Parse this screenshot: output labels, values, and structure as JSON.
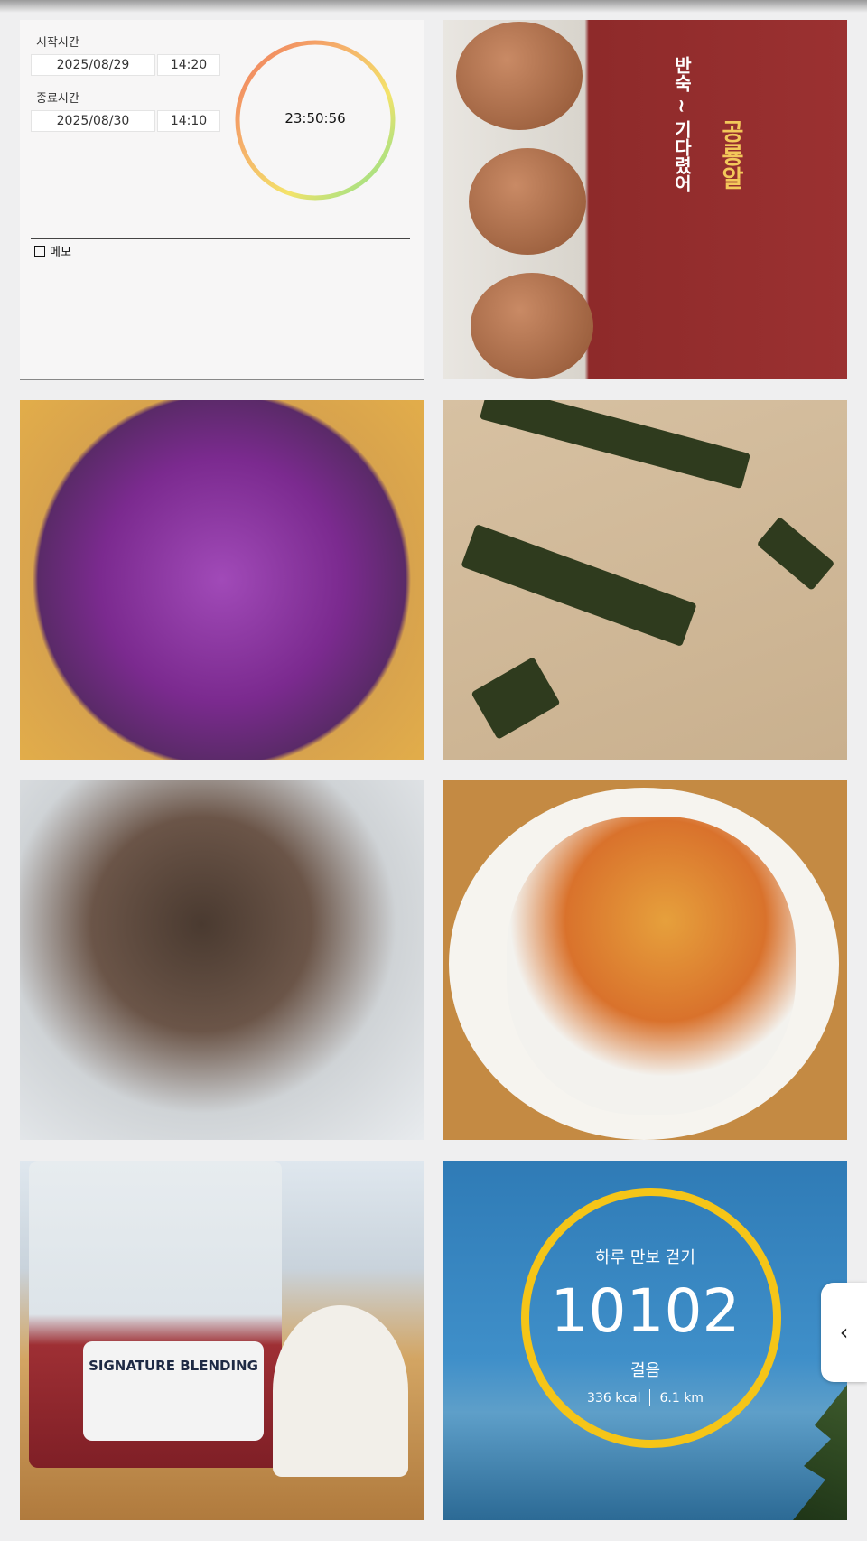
{
  "fasting": {
    "start_label": "시작시간",
    "start_date": "2025/08/29",
    "start_time": "14:20",
    "end_label": "종료시간",
    "end_date": "2025/08/30",
    "end_time": "14:10",
    "elapsed": "23:50:56",
    "memo_label": "메모"
  },
  "photos": {
    "egg_box_text": "공룡알",
    "egg_box_sub": "반숙 ~ 기다렸어",
    "drink_label": "SIGNATURE BLENDING"
  },
  "walk": {
    "title": "하루 만보 걷기",
    "steps": "10102",
    "unit": "걸음",
    "kcal": "336 kcal",
    "distance": "6.1 km",
    "ring_color": "#f5c518"
  },
  "side_tab_icon": "chevron-left-icon"
}
